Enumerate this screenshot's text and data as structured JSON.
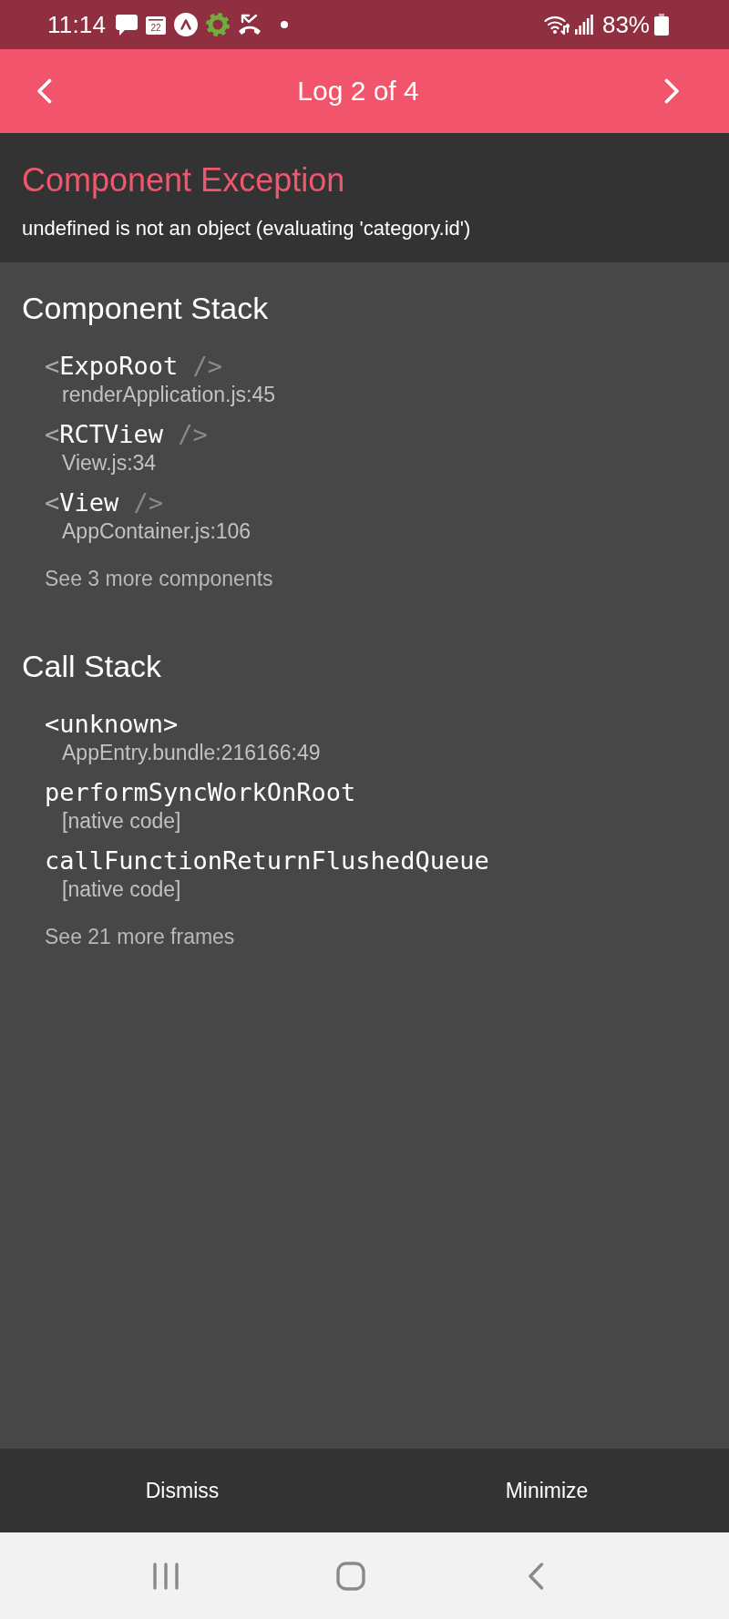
{
  "status_bar": {
    "time": "11:14",
    "calendar_day": "22",
    "battery": "83%"
  },
  "header": {
    "title": "Log 2 of 4"
  },
  "error": {
    "title": "Component Exception",
    "message": "undefined is not an object (evaluating 'category.id')"
  },
  "component_stack": {
    "title": "Component Stack",
    "frames": [
      {
        "open": "<",
        "name": "ExpoRoot",
        "close": "/>",
        "location": "renderApplication.js:45"
      },
      {
        "open": "<",
        "name": "RCTView",
        "close": "/>",
        "location": "View.js:34"
      },
      {
        "open": "<",
        "name": "View",
        "close": "/>",
        "location": "AppContainer.js:106"
      }
    ],
    "more": "See 3 more components"
  },
  "call_stack": {
    "title": "Call Stack",
    "frames": [
      {
        "name": "<unknown>",
        "location": "AppEntry.bundle:216166:49"
      },
      {
        "name": "performSyncWorkOnRoot",
        "location": "[native code]"
      },
      {
        "name": "callFunctionReturnFlushedQueue",
        "location": "[native code]"
      }
    ],
    "more": "See 21 more frames"
  },
  "footer": {
    "buttons": [
      "Dismiss",
      "Minimize"
    ]
  }
}
